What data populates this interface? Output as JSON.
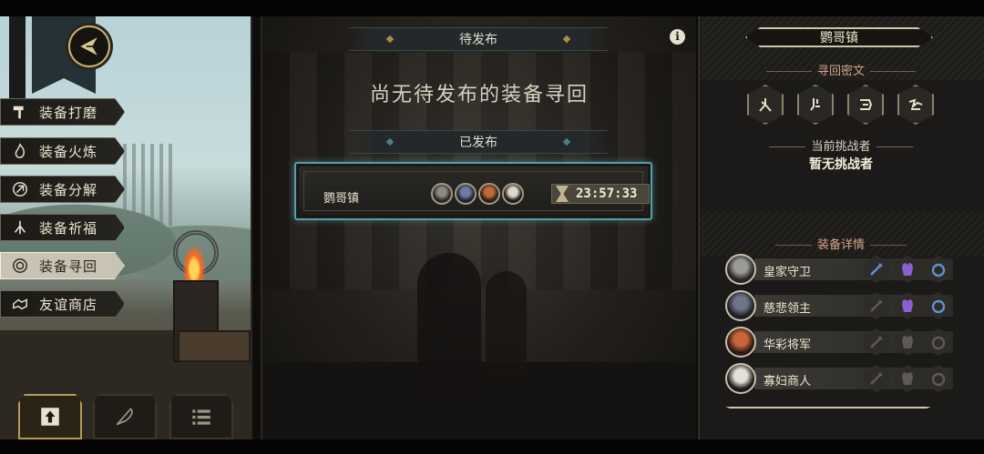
{
  "menu": {
    "items": [
      {
        "label": "装备打磨",
        "icon": "hammer-icon",
        "active": false
      },
      {
        "label": "装备火炼",
        "icon": "flame-icon",
        "active": false
      },
      {
        "label": "装备分解",
        "icon": "disassemble-icon",
        "active": false
      },
      {
        "label": "装备祈福",
        "icon": "pray-hands-icon",
        "active": false
      },
      {
        "label": "装备寻回",
        "icon": "spiral-icon",
        "active": true
      },
      {
        "label": "友谊商店",
        "icon": "handshake-icon",
        "active": false
      }
    ]
  },
  "bottom_nav": [
    {
      "icon": "upload-arrow-icon",
      "active": true
    },
    {
      "icon": "feather-icon",
      "active": false
    },
    {
      "icon": "list-icon",
      "active": false
    }
  ],
  "pending": {
    "header": "待发布",
    "empty_text": "尚无待发布的装备寻回"
  },
  "published": {
    "header": "已发布",
    "quest": {
      "town": "鹦哥镇",
      "timer": "23:57:33",
      "portrait_count": 4
    }
  },
  "info_label": "i",
  "right": {
    "town_title": "鹦哥镇",
    "cipher_title": "寻回密文",
    "cipher_icons": [
      "rune-1-icon",
      "rune-2-icon",
      "rune-3-icon",
      "rune-4-icon"
    ],
    "challenger_label": "当前挑战者",
    "challenger_value": "暂无挑战者",
    "detail_title": "装备详情",
    "details": [
      {
        "name": "皇家守卫",
        "weapon_active": true,
        "armor_active": true,
        "ring_active": true
      },
      {
        "name": "慈悲领主",
        "weapon_active": false,
        "armor_active": true,
        "ring_active": true
      },
      {
        "name": "华彩将军",
        "weapon_active": false,
        "armor_active": false,
        "ring_active": false
      },
      {
        "name": "寡妇商人",
        "weapon_active": false,
        "armor_active": false,
        "ring_active": false
      }
    ]
  },
  "colors": {
    "accent_teal": "#53a0ab",
    "gold": "#cfc6aa",
    "slot_active_blue": "#5f8fd1",
    "slot_active_purple": "#8a5fd1",
    "slot_inactive": "#5d5a53"
  }
}
